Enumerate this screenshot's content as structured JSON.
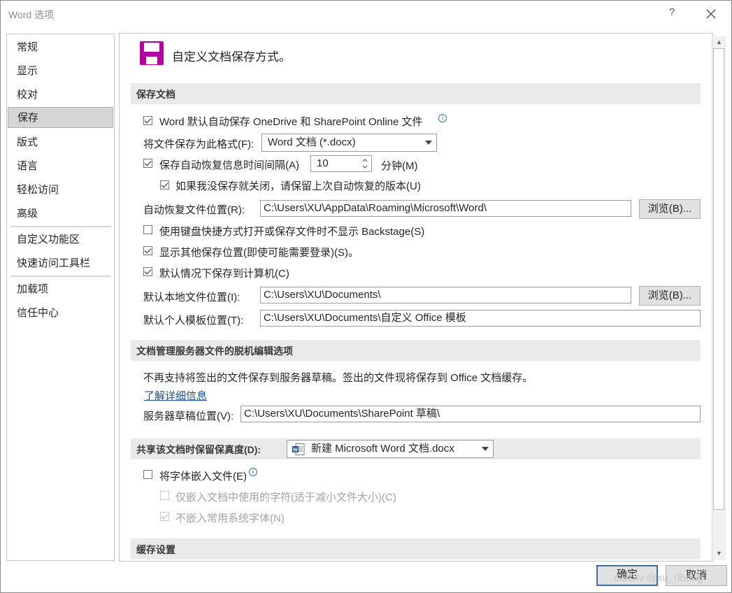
{
  "window": {
    "title": "Word 选项",
    "help": "?"
  },
  "nav": {
    "items": [
      "常规",
      "显示",
      "校对",
      "保存",
      "版式",
      "语言",
      "轻松访问",
      "高级",
      "自定义功能区",
      "快速访问工具栏",
      "加载项",
      "信任中心"
    ],
    "selected": "保存"
  },
  "page": {
    "heading": "自定义文档保存方式。"
  },
  "save_documents": {
    "section_title": "保存文档",
    "autosave_label": "Word 默认自动保存 OneDrive 和 SharePoint Online 文件",
    "autosave_checked": true,
    "format_label": "将文件保存为此格式(F):",
    "format_value": "Word 文档 (*.docx)",
    "autorecover_label": "保存自动恢复信息时间间隔(A)",
    "autorecover_checked": true,
    "autorecover_minutes": "10",
    "minutes_unit": "分钟(M)",
    "keep_last_label": "如果我没保存就关闭，请保留上次自动恢复的版本(U)",
    "keep_last_checked": true,
    "autorecover_location_label": "自动恢复文件位置(R):",
    "autorecover_location_value": "C:\\Users\\XU\\AppData\\Roaming\\Microsoft\\Word\\",
    "browse_label_1": "浏览(B)...",
    "backstage_label": "使用键盘快捷方式打开或保存文件时不显示 Backstage(S)",
    "backstage_checked": false,
    "show_more_label": "显示其他保存位置(即使可能需要登录)(S)。",
    "show_more_checked": true,
    "save_to_computer_label": "默认情况下保存到计算机(C)",
    "save_to_computer_checked": true,
    "local_location_label": "默认本地文件位置(I):",
    "local_location_value": "C:\\Users\\XU\\Documents\\",
    "browse_label_2": "浏览(B)...",
    "template_location_label": "默认个人模板位置(T):",
    "template_location_value": "C:\\Users\\XU\\Documents\\自定义 Office 模板"
  },
  "offline_editing": {
    "section_title": "文档管理服务器文件的脱机编辑选项",
    "description": "不再支持将签出的文件保存到服务器草稿。签出的文件现将保存到 Office 文档缓存。",
    "learn_more": "了解详细信息",
    "drafts_label": "服务器草稿位置(V):",
    "drafts_value": "C:\\Users\\XU\\Documents\\SharePoint 草稿\\"
  },
  "fidelity": {
    "section_title": "共享该文档时保留保真度(D):",
    "document": "新建 Microsoft Word 文档.docx",
    "embed_fonts_label": "将字体嵌入文件(E)",
    "embed_fonts_checked": false,
    "embed_used_label": "仅嵌入文档中使用的字符(适于减小文件大小)(C)",
    "embed_used_checked": false,
    "no_common_label": "不嵌入常用系统字体(N)",
    "no_common_checked": true
  },
  "cache": {
    "section_title": "缓存设置"
  },
  "footer": {
    "ok": "确定",
    "cancel": "取消",
    "watermark": "CSDN @xu_dbdug"
  },
  "colors": {
    "selected_nav": "#d5d5d5",
    "section_bar": "#eaeaea",
    "link": "#1f4e9a",
    "save_icon": "#b4009e"
  }
}
